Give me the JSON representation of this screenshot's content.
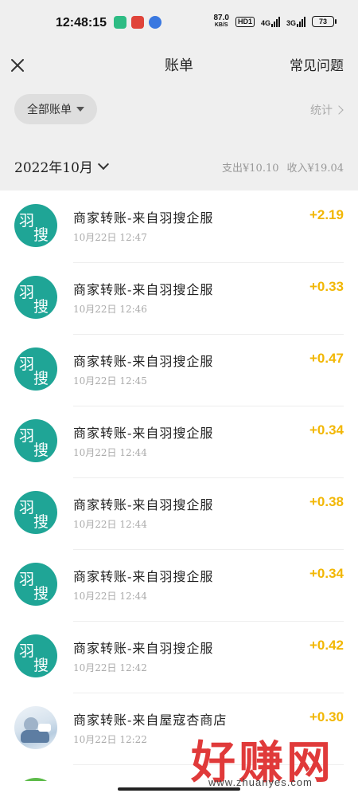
{
  "status_bar": {
    "time": "12:48:15",
    "net_speed_value": "87.0",
    "net_speed_unit": "KB/S",
    "hd_label": "HD1",
    "sig1_label": "4G",
    "sig2_label": "3G",
    "battery": "73"
  },
  "header": {
    "title": "账单",
    "faq_label": "常见问题"
  },
  "filter": {
    "all_bills_label": "全部账单",
    "stats_label": "统计"
  },
  "month_bar": {
    "month_label": "2022年10月",
    "expense_summary": "支出¥10.10",
    "income_summary": "收入¥19.04"
  },
  "transactions": [
    {
      "avatar_char1": "羽",
      "avatar_char2": "搜",
      "merchant": "商家转账-来自羽搜企服",
      "time": "10月22日 12:47",
      "amount": "+2.19"
    },
    {
      "avatar_char1": "羽",
      "avatar_char2": "搜",
      "merchant": "商家转账-来自羽搜企服",
      "time": "10月22日 12:46",
      "amount": "+0.33"
    },
    {
      "avatar_char1": "羽",
      "avatar_char2": "搜",
      "merchant": "商家转账-来自羽搜企服",
      "time": "10月22日 12:45",
      "amount": "+0.47"
    },
    {
      "avatar_char1": "羽",
      "avatar_char2": "搜",
      "merchant": "商家转账-来自羽搜企服",
      "time": "10月22日 12:44",
      "amount": "+0.34"
    },
    {
      "avatar_char1": "羽",
      "avatar_char2": "搜",
      "merchant": "商家转账-来自羽搜企服",
      "time": "10月22日 12:44",
      "amount": "+0.38"
    },
    {
      "avatar_char1": "羽",
      "avatar_char2": "搜",
      "merchant": "商家转账-来自羽搜企服",
      "time": "10月22日 12:44",
      "amount": "+0.34"
    },
    {
      "avatar_char1": "羽",
      "avatar_char2": "搜",
      "merchant": "商家转账-来自羽搜企服",
      "time": "10月22日 12:42",
      "amount": "+0.42"
    },
    {
      "merchant": "商家转账-来自屋寇杏商店",
      "time": "10月22日 12:22",
      "amount": "+0.30"
    }
  ],
  "watermark": {
    "text": "好赚网",
    "url": "www.zhuanyes.com"
  },
  "colors": {
    "accent_amount": "#f2b705",
    "avatar_teal": "#1fa596",
    "header_bg": "#efefef",
    "watermark_red": "#e03a3a"
  },
  "icons": {
    "close": "close-icon",
    "dropdown": "caret-down-icon",
    "stats_arrow": "chevron-right-icon",
    "month_arrow": "chevron-down-icon"
  }
}
